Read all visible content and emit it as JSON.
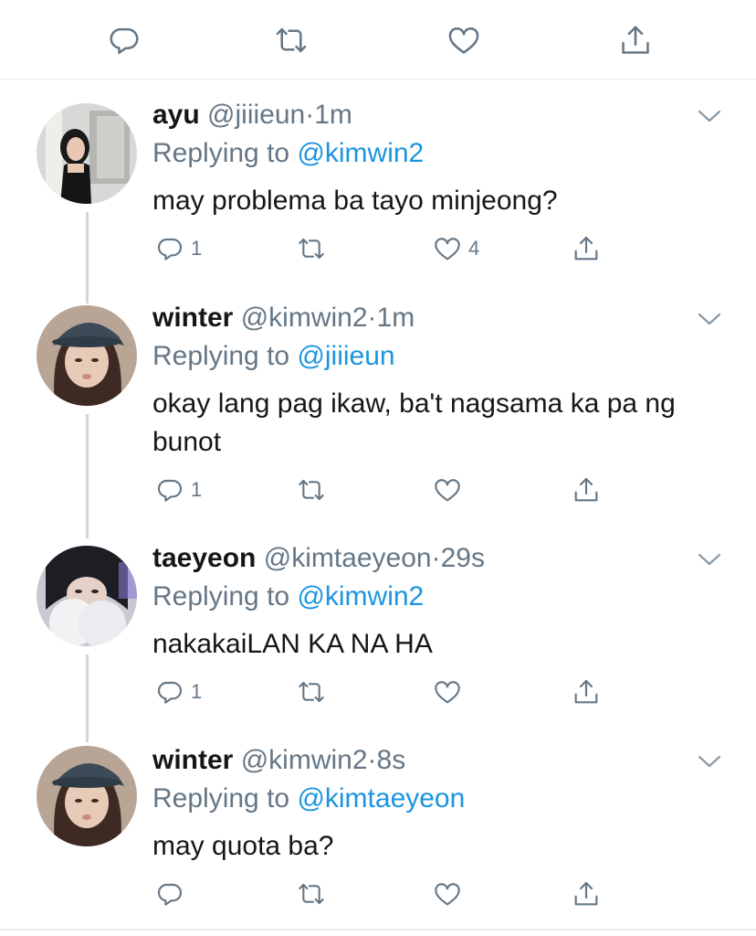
{
  "top_actions": {
    "icons": [
      "reply-icon",
      "retweet-icon",
      "like-icon",
      "share-icon"
    ]
  },
  "tweets": [
    {
      "name": "ayu",
      "handle": "@jiiieun",
      "time": "1m",
      "replying_label": "Replying to",
      "replying_to": "@kimwin2",
      "text": "may problema ba tayo minjeong?",
      "reply_count": "1",
      "retweet_count": "",
      "like_count": "4"
    },
    {
      "name": "winter",
      "handle": "@kimwin2",
      "time": "1m",
      "replying_label": "Replying to",
      "replying_to": "@jiiieun",
      "text": "okay lang pag ikaw, ba't nagsama ka pa ng bunot",
      "reply_count": "1",
      "retweet_count": "",
      "like_count": ""
    },
    {
      "name": "taeyeon",
      "handle": "@kimtaeyeon",
      "time": "29s",
      "replying_label": "Replying to",
      "replying_to": "@kimwin2",
      "text": "nakakaiLAN KA NA HA",
      "reply_count": "1",
      "retweet_count": "",
      "like_count": ""
    },
    {
      "name": "winter",
      "handle": "@kimwin2",
      "time": "8s",
      "replying_label": "Replying to",
      "replying_to": "@kimtaeyeon",
      "text": "may quota ba?",
      "reply_count": "",
      "retweet_count": "",
      "like_count": ""
    }
  ],
  "separator": "·",
  "colors": {
    "text": "#14171a",
    "secondary": "#657786",
    "link": "#1b95e0",
    "divider": "#e6ecf0",
    "thread_line": "#ccd6dd"
  }
}
